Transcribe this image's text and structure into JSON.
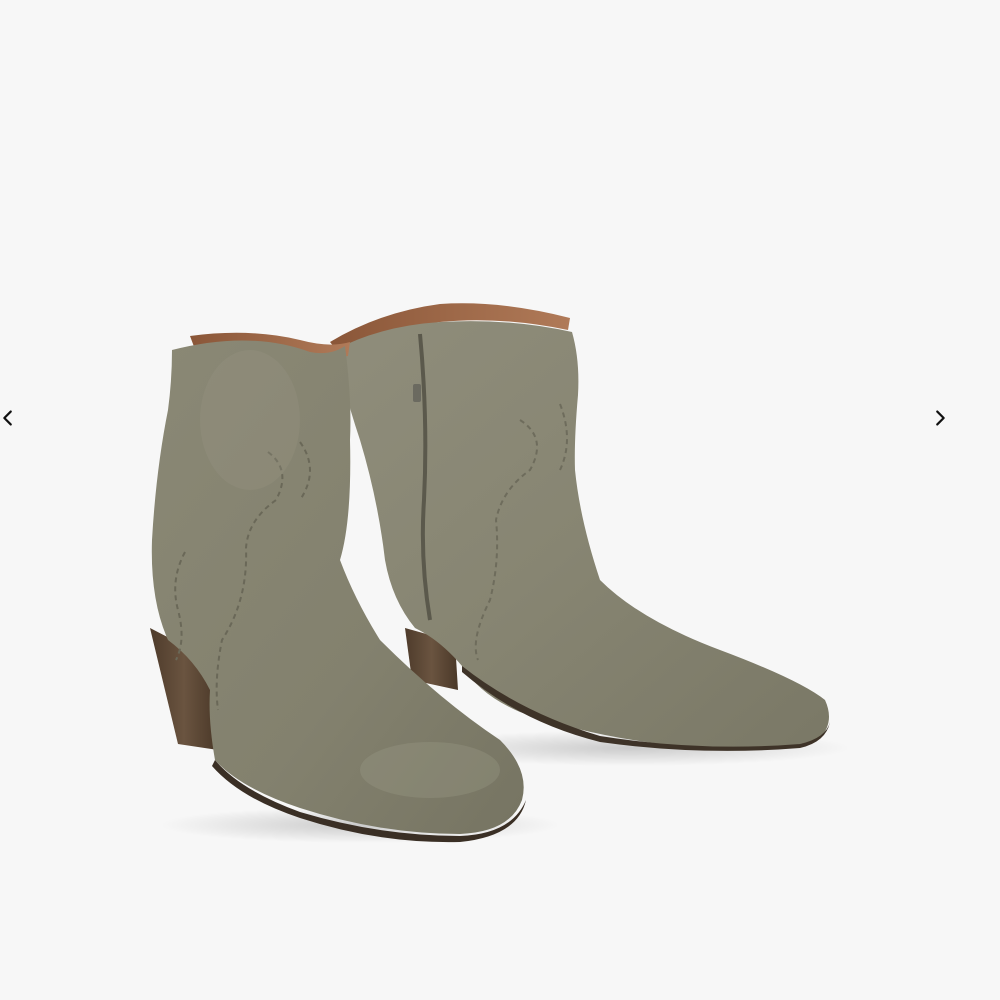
{
  "gallery": {
    "prev_icon": "chevron-left-icon",
    "next_icon": "chevron-right-icon",
    "image_subject": "ankle-boots-product-photo",
    "colors": {
      "background": "#f7f7f7",
      "suede": "#8c8a78",
      "heel": "#5a4634",
      "lining": "#a0694a",
      "arrow": "#111111"
    }
  }
}
